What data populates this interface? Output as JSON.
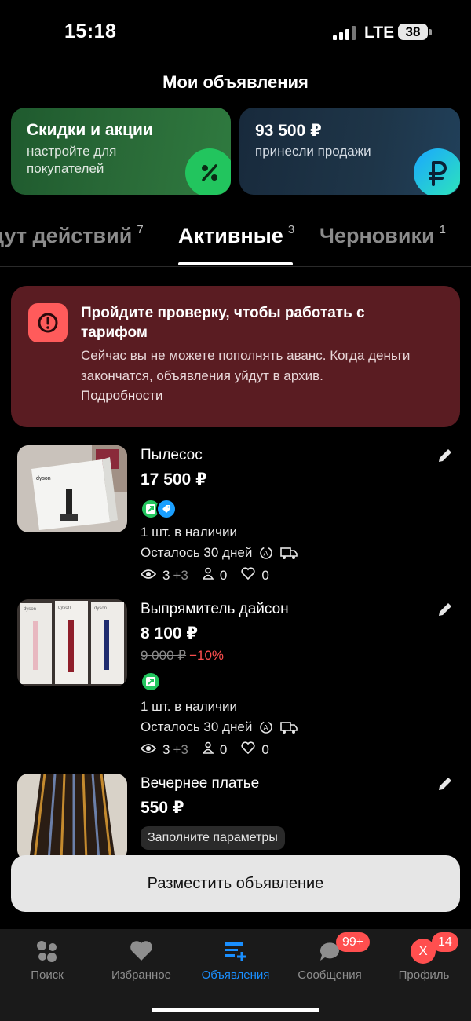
{
  "status_bar": {
    "time": "15:18",
    "network": "LTE",
    "battery": "38"
  },
  "header": {
    "title": "Мои объявления"
  },
  "promo_cards": [
    {
      "title": "Скидки и акции",
      "subtitle": "настройте для покупателей",
      "icon": "percent-icon",
      "color": "#22c55e"
    },
    {
      "title": "93 500 ₽",
      "subtitle": "принесли продажи",
      "icon": "ruble-icon",
      "color": "#1aa7ff"
    }
  ],
  "tabs": [
    {
      "label": "дут действий",
      "count": "7"
    },
    {
      "label": "Активные",
      "count": "3",
      "active": true
    },
    {
      "label": "Черновики",
      "count": "1"
    }
  ],
  "alert": {
    "title": "Пройдите проверку, чтобы работать с тарифом",
    "text": "Сейчас вы не можете пополнять аванс. Когда деньги закончатся, объявления уйдут в архив.",
    "link": "Подробности"
  },
  "listings": [
    {
      "title": "Пылесос",
      "price": "17 500 ₽",
      "stock": "1 шт. в наличии",
      "days_left": "Осталось 30 дней",
      "views": "3",
      "views_delta": "+3",
      "contacts": "0",
      "favorites": "0"
    },
    {
      "title": "Выпрямитель дайсон",
      "price": "8 100 ₽",
      "old_price": "9 000 ₽",
      "discount": "−10%",
      "stock": "1 шт. в наличии",
      "days_left": "Осталось 30 дней",
      "views": "3",
      "views_delta": "+3",
      "contacts": "0",
      "favorites": "0"
    },
    {
      "title": "Вечернее платье",
      "price": "550 ₽",
      "chip": "Заполните параметры"
    }
  ],
  "post_button": {
    "label": "Разместить объявление"
  },
  "bottom_nav": {
    "items": [
      {
        "label": "Поиск",
        "icon": "search-dots-icon"
      },
      {
        "label": "Избранное",
        "icon": "heart-icon"
      },
      {
        "label": "Объявления",
        "icon": "listings-icon",
        "active": true
      },
      {
        "label": "Сообщения",
        "icon": "chat-icon",
        "badge": "99+"
      },
      {
        "label": "Профиль",
        "icon": "avatar",
        "avatar_letter": "X",
        "badge": "14"
      }
    ]
  },
  "colors": {
    "accent": "#1a8fff",
    "alert_bg": "#5a1c22",
    "danger": "#ff4f4f",
    "success": "#22c55e"
  }
}
